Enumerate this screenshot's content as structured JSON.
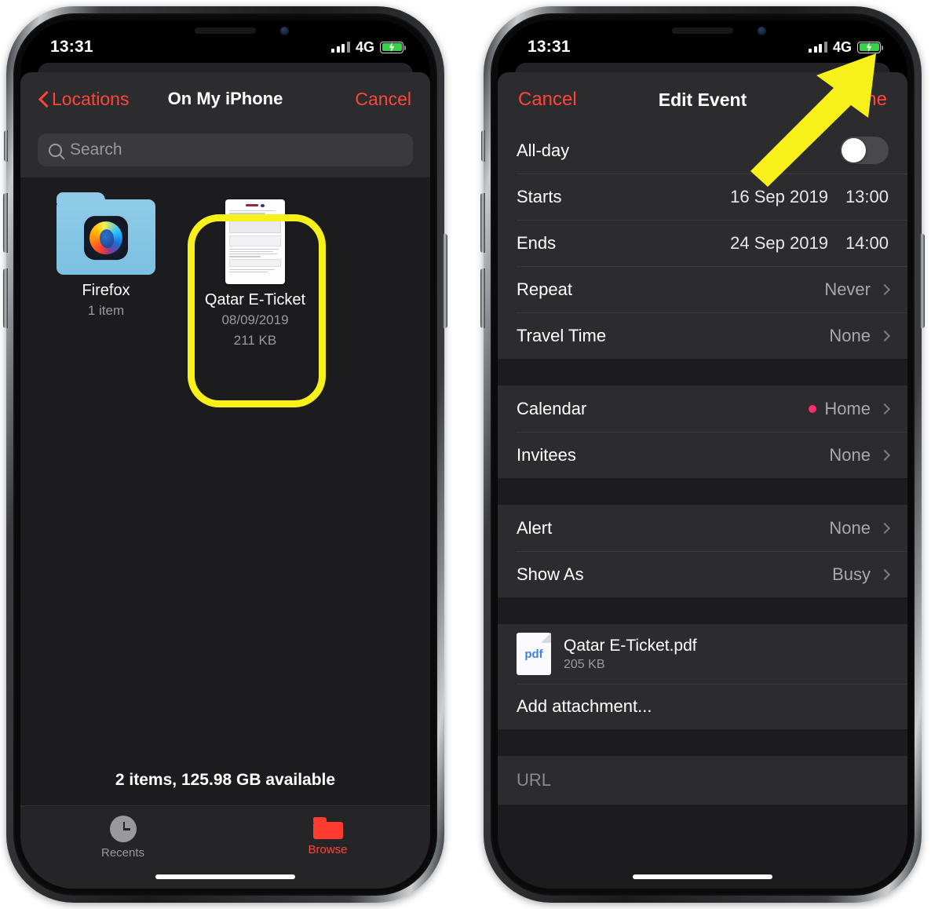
{
  "left_phone": {
    "status_bar": {
      "time": "13:31",
      "network": "4G",
      "battery_state": "charging",
      "signal_bars": 4
    },
    "nav": {
      "back_label": "Locations",
      "title": "On My iPhone",
      "action_label": "Cancel"
    },
    "search": {
      "placeholder": "Search"
    },
    "files": [
      {
        "name": "Firefox",
        "meta1": "1 item",
        "meta2": "",
        "kind": "folder",
        "highlighted": false
      },
      {
        "name": "Qatar E-Ticket",
        "meta1": "08/09/2019",
        "meta2": "211 KB",
        "kind": "document",
        "highlighted": true
      }
    ],
    "storage_status": "2 items, 125.98 GB available",
    "tabs": [
      {
        "label": "Recents",
        "icon": "clock-icon",
        "active": false
      },
      {
        "label": "Browse",
        "icon": "folder-icon",
        "active": true
      }
    ]
  },
  "right_phone": {
    "status_bar": {
      "time": "13:31",
      "network": "4G",
      "battery_state": "charging",
      "signal_bars": 4
    },
    "nav": {
      "cancel_label": "Cancel",
      "title": "Edit Event",
      "done_label": "Done"
    },
    "rows_group1": [
      {
        "label": "All-day",
        "type": "toggle",
        "value": "off"
      },
      {
        "label": "Starts",
        "type": "datetime",
        "date": "16 Sep 2019",
        "time": "13:00"
      },
      {
        "label": "Ends",
        "type": "datetime",
        "date": "24 Sep 2019",
        "time": "14:00"
      },
      {
        "label": "Repeat",
        "type": "disclosure",
        "value": "Never"
      },
      {
        "label": "Travel Time",
        "type": "disclosure",
        "value": "None"
      }
    ],
    "rows_group2": [
      {
        "label": "Calendar",
        "type": "disclosure-dot",
        "value": "Home",
        "dot_color": "#ff2d6f"
      },
      {
        "label": "Invitees",
        "type": "disclosure",
        "value": "None"
      }
    ],
    "rows_group3": [
      {
        "label": "Alert",
        "type": "disclosure",
        "value": "None"
      },
      {
        "label": "Show As",
        "type": "disclosure",
        "value": "Busy"
      }
    ],
    "attachment": {
      "name": "Qatar E-Ticket.pdf",
      "size": "205 KB",
      "icon_label": "pdf"
    },
    "add_attachment_label": "Add attachment...",
    "url_field": {
      "placeholder": "URL",
      "value": ""
    }
  },
  "annotations": {
    "highlight_color": "#f7f01b",
    "arrow_color": "#f7f01b",
    "arrow_target": "Done"
  }
}
